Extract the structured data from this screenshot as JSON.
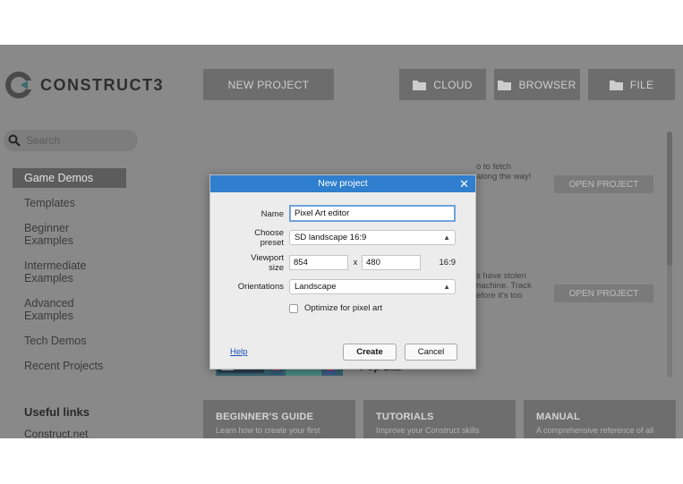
{
  "header": {
    "logo_text": "CONSTRUCT3",
    "new_project": "NEW PROJECT",
    "cloud": "CLOUD",
    "browser": "BROWSER",
    "file": "FILE"
  },
  "sidebar": {
    "search_placeholder": "Search",
    "items": [
      {
        "label": "Game Demos"
      },
      {
        "label": "Templates"
      },
      {
        "label": "Beginner Examples"
      },
      {
        "label": "Intermediate Examples"
      },
      {
        "label": "Advanced Examples"
      },
      {
        "label": "Tech Demos"
      },
      {
        "label": "Recent Projects"
      }
    ],
    "useful_links_title": "Useful links",
    "useful_link_1": "Construct.net"
  },
  "cards": {
    "card1_text_line1": "o to fetch",
    "card1_text_line2": "along the way!",
    "card2_text_line1": "s have stolen",
    "card2_text_line2": "nachine. Track",
    "card2_text_line3": "efore it's too",
    "open_project": "OPEN PROJECT",
    "poplab_title": "Pop Lab"
  },
  "guides": [
    {
      "title": "BEGINNER'S GUIDE",
      "desc": "Learn how to create your first"
    },
    {
      "title": "TUTORIALS",
      "desc": "Improve your Construct skills"
    },
    {
      "title": "MANUAL",
      "desc": "A comprehensive reference of all"
    }
  ],
  "dialog": {
    "title": "New project",
    "close_glyph": "✕",
    "name_label": "Name",
    "name_value": "Pixel Art editor",
    "preset_label_1": "Choose",
    "preset_label_2": "preset",
    "preset_value": "SD landscape 16:9",
    "viewport_label_1": "Viewport",
    "viewport_label_2": "size",
    "viewport_width": "854",
    "viewport_x": "x",
    "viewport_height": "480",
    "aspect": "16:9",
    "orientations_label": "Orientations",
    "orientation_value": "Landscape",
    "optimize_label": "Optimize for pixel art",
    "help": "Help",
    "create": "Create",
    "cancel": "Cancel"
  },
  "colors": {
    "dialog_title_bar": "#2f7fce",
    "overlay_bg": "#898989"
  }
}
